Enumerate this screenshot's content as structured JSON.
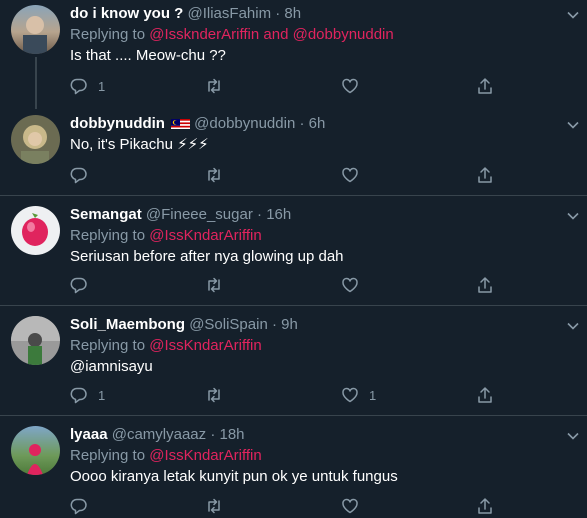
{
  "tweets": [
    {
      "name": "do i know you ?",
      "handle": "@IliasFahim",
      "time": "8h",
      "replying_prefix": "Replying to",
      "reply_mentions": [
        "@IssknderAriffin",
        "@dobbynuddin"
      ],
      "reply_joiner": "and",
      "text": "Is that .... Meow-chu ??",
      "reply_count": "1",
      "like_count": ""
    },
    {
      "name": "dobbynuddin",
      "flag": "malaysia-flag",
      "handle": "@dobbynuddin",
      "time": "6h",
      "text": "No, it's Pikachu ⚡⚡⚡",
      "reply_count": "",
      "like_count": ""
    },
    {
      "name": "Semangat",
      "handle": "@Fineee_sugar",
      "time": "16h",
      "replying_prefix": "Replying to",
      "reply_mentions": [
        "@IssKndarAriffin"
      ],
      "text": "Seriusan before after nya glowing up dah",
      "reply_count": "",
      "like_count": ""
    },
    {
      "name": "Soli_Maembong",
      "handle": "@SoliSpain",
      "time": "9h",
      "replying_prefix": "Replying to",
      "reply_mentions": [
        "@IssKndarAriffin"
      ],
      "text": "@iamnisayu",
      "reply_count": "1",
      "like_count": "1"
    },
    {
      "name": "lyaaa",
      "handle": "@camylyaaaz",
      "time": "18h",
      "replying_prefix": "Replying to",
      "reply_mentions": [
        "@IssKndarAriffin"
      ],
      "text": "Oooo kiranya letak kunyit pun ok ye untuk fungus",
      "reply_count": "",
      "like_count": ""
    }
  ],
  "separator": "·",
  "icons": {
    "reply": "reply-icon",
    "retweet": "retweet-icon",
    "like": "like-icon",
    "share": "share-icon",
    "more": "chevron-down-icon"
  },
  "colors": {
    "background": "#15202b",
    "mention": "#e0245e",
    "muted": "#8899a6",
    "divider": "#38444d"
  }
}
